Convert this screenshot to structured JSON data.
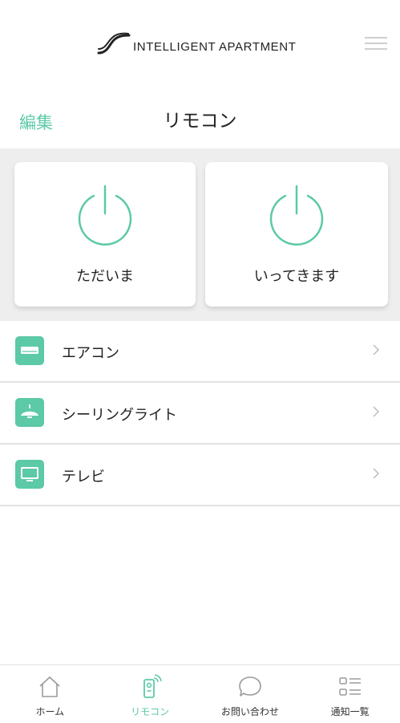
{
  "header": {
    "brand": "INTELLIGENT APARTMENT",
    "logo_icon": "wave-logo-icon",
    "menu_icon": "hamburger-menu-icon"
  },
  "title_row": {
    "edit_label": "編集",
    "page_title": "リモコン"
  },
  "quick_actions": [
    {
      "label": "ただいま",
      "icon": "power-icon"
    },
    {
      "label": "いってきます",
      "icon": "power-icon"
    }
  ],
  "devices": [
    {
      "label": "エアコン",
      "icon": "air-conditioner-icon"
    },
    {
      "label": "シーリングライト",
      "icon": "ceiling-light-icon"
    },
    {
      "label": "テレビ",
      "icon": "tv-icon"
    }
  ],
  "bottom_nav": [
    {
      "label": "ホーム",
      "icon": "home-icon",
      "active": false
    },
    {
      "label": "リモコン",
      "icon": "remote-icon",
      "active": true
    },
    {
      "label": "お問い合わせ",
      "icon": "chat-bubble-icon",
      "active": false
    },
    {
      "label": "通知一覧",
      "icon": "list-icon",
      "active": false
    }
  ],
  "colors": {
    "accent": "#5cc9a7",
    "background_panel": "#eeeeee",
    "divider": "#e2e2e2"
  }
}
